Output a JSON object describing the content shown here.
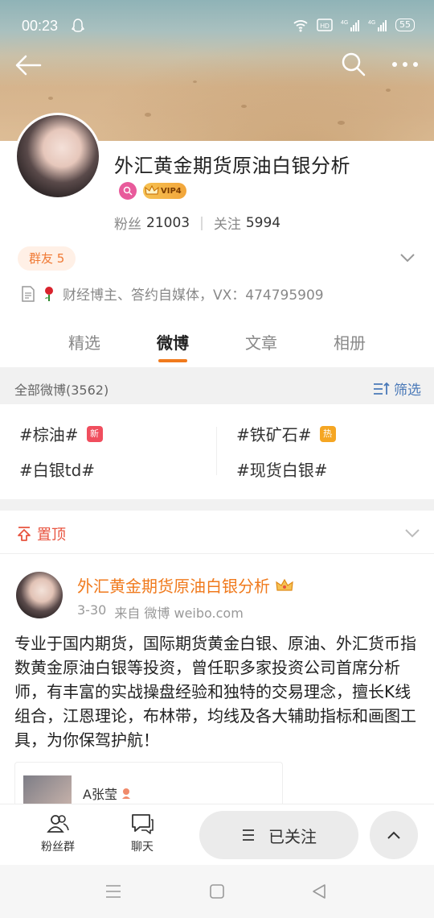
{
  "status_bar": {
    "time": "00:23",
    "battery": "55"
  },
  "profile": {
    "name": "外汇黄金期货原油白银分析",
    "vip_label": "VIP4",
    "fans_label": "粉丝",
    "fans_count": "21003",
    "follow_label": "关注",
    "follow_count": "5994",
    "group_chip": "群友 5",
    "bio": "财经博主、答约自媒体，VX：474795909"
  },
  "tabs": [
    {
      "label": "精选"
    },
    {
      "label": "微博"
    },
    {
      "label": "文章"
    },
    {
      "label": "相册"
    }
  ],
  "active_tab": "微博",
  "feed_header": {
    "all_posts": "全部微博(3562)",
    "filter": "筛选"
  },
  "hashtags": [
    {
      "label": "#棕油#",
      "badge": "新",
      "badge_color": "#f04e5e"
    },
    {
      "label": "#铁矿石#",
      "badge": "热",
      "badge_color": "#f5a623"
    },
    {
      "label": "#白银td#"
    },
    {
      "label": "#现货白银#"
    }
  ],
  "pinned": {
    "label": "置顶"
  },
  "post": {
    "author": "外汇黄金期货原油白银分析",
    "date": "3-30",
    "source": "来自 微博 weibo.com",
    "text": "专业于国内期货，国际期货黄金白银、原油、外汇货币指数黄金原油白银等投资，曾任职多家投资公司首席分析师，有丰富的实战操盘经验和独特的交易理念，擅长K线组合，江恩理论，布林带，均线及各大辅助指标和画图工具，为你保驾护航！",
    "card_name": "A张莹"
  },
  "bottom_bar": {
    "fans_group": "粉丝群",
    "chat": "聊天",
    "followed": "已关注"
  },
  "colors": {
    "accent_orange": "#f07a1d",
    "link_blue": "#4a79b8",
    "pinned_red": "#e8533f"
  }
}
